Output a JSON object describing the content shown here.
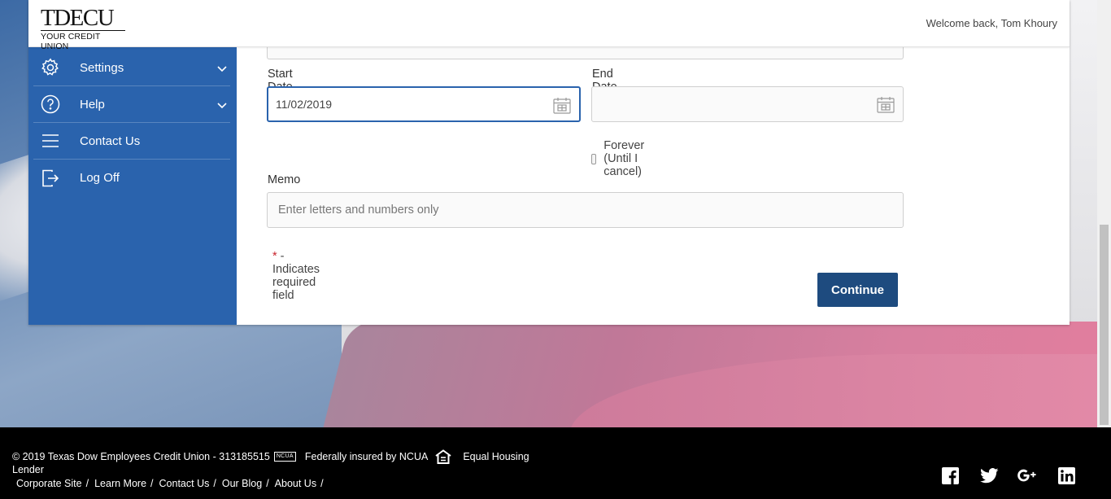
{
  "header": {
    "logo_brand": "TDECU",
    "logo_tagline": "YOUR CREDIT UNION",
    "welcome": "Welcome back, Tom Khoury"
  },
  "sidebar": {
    "items": [
      {
        "label": "Settings",
        "icon": "gear-icon",
        "expandable": true
      },
      {
        "label": "Help",
        "icon": "question-circle-icon",
        "expandable": true
      },
      {
        "label": "Contact Us",
        "icon": "menu-lines-icon",
        "expandable": false
      },
      {
        "label": "Log Off",
        "icon": "log-off-icon",
        "expandable": false
      }
    ]
  },
  "form": {
    "start_date": {
      "label": "Start Date",
      "required_mark": "*",
      "value": "11/02/2019"
    },
    "end_date": {
      "label": "End Date",
      "required_mark": "*",
      "value": ""
    },
    "forever": {
      "label": "Forever (Until I cancel)",
      "checked": false
    },
    "memo": {
      "label": "Memo",
      "placeholder": "Enter letters and numbers only",
      "value": ""
    },
    "required_note": {
      "mark": "*",
      "text": " - Indicates required field"
    },
    "continue_label": "Continue"
  },
  "footer": {
    "copyright": "© 2019 Texas Dow Employees Credit Union - 313185515",
    "ncua_badge": "NCUA",
    "insured": "Federally insured by NCUA",
    "housing_line1": "Equal Housing",
    "housing_line2": "Lender",
    "links": [
      "Corporate Site",
      "Learn More",
      "Contact Us",
      "Our Blog",
      "About Us"
    ],
    "link_separator": "/",
    "social": [
      "facebook-icon",
      "twitter-icon",
      "google-plus-icon",
      "linkedin-icon"
    ]
  },
  "colors": {
    "sidebar": "#2a63ad",
    "button": "#1e4b7f",
    "required": "#c8232c",
    "footer": "#000000"
  }
}
